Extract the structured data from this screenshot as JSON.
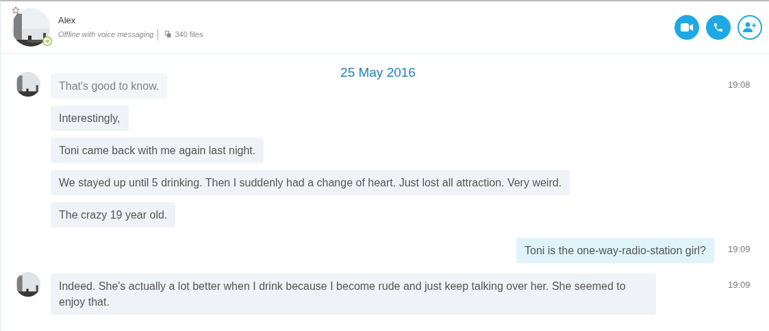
{
  "contact": {
    "name": "Alex",
    "status": "Offline with voice messaging",
    "files": "340 files",
    "favorite": false
  },
  "actions": [
    {
      "kind": "video"
    },
    {
      "kind": "call"
    },
    {
      "kind": "add"
    }
  ],
  "date": "25 May 2016",
  "messages": [
    {
      "kind": "received",
      "avatar": true,
      "text": "That's good to know.",
      "time": "19:08"
    },
    {
      "kind": "received",
      "avatar": false,
      "text": "Interestingly,"
    },
    {
      "kind": "received",
      "avatar": false,
      "text": "Toni came back with me again last night."
    },
    {
      "kind": "received",
      "avatar": false,
      "text": "We stayed up until 5 drinking. Then I suddenly had a change of heart. Just lost all attraction. Very weird."
    },
    {
      "kind": "received",
      "avatar": false,
      "text": "The crazy 19 year old."
    },
    {
      "kind": "sent",
      "text": "Toni is the one-way-radio-station girl?",
      "time": "19:09"
    },
    {
      "kind": "received",
      "avatar": true,
      "text": "Indeed. She's actually a lot better when I drink because I become rude and just keep talking over her. She seemed to enjoy that.",
      "time": "19:09"
    }
  ]
}
